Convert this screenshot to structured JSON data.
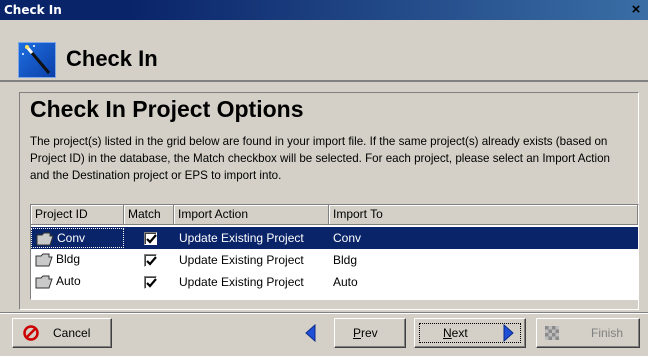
{
  "window": {
    "title": "Check In",
    "close_glyph": "×"
  },
  "header": {
    "title": "Check In",
    "icon": "magic-wand-icon"
  },
  "panel": {
    "title": "Check In Project Options",
    "description": "The project(s) listed in the grid below are found in your import file. If the same project(s) already exists (based on Project ID) in the database, the Match checkbox will be selected.  For each project, please select an Import Action and the Destination project or EPS to import into."
  },
  "grid": {
    "columns": [
      "Project ID",
      "Match",
      "Import Action",
      "Import To"
    ],
    "rows": [
      {
        "project_id": "Conv",
        "match": true,
        "import_action": "Update Existing Project",
        "import_to": "Conv",
        "selected": true
      },
      {
        "project_id": "Bldg",
        "match": true,
        "import_action": "Update Existing Project",
        "import_to": "Bldg",
        "selected": false
      },
      {
        "project_id": "Auto",
        "match": true,
        "import_action": "Update Existing Project",
        "import_to": "Auto",
        "selected": false
      }
    ]
  },
  "buttons": {
    "cancel": "Cancel",
    "prev_pre": "",
    "prev_u": "P",
    "prev_post": "rev",
    "next_pre": "",
    "next_u": "N",
    "next_post": "ext",
    "finish": "Finish"
  },
  "colors": {
    "selection": "#0a246a",
    "title_bar": "#0a246a",
    "dialog_bg": "#d4d0c8",
    "arrow_blue": "#1f4fd6",
    "cancel_red": "#cc0000"
  }
}
